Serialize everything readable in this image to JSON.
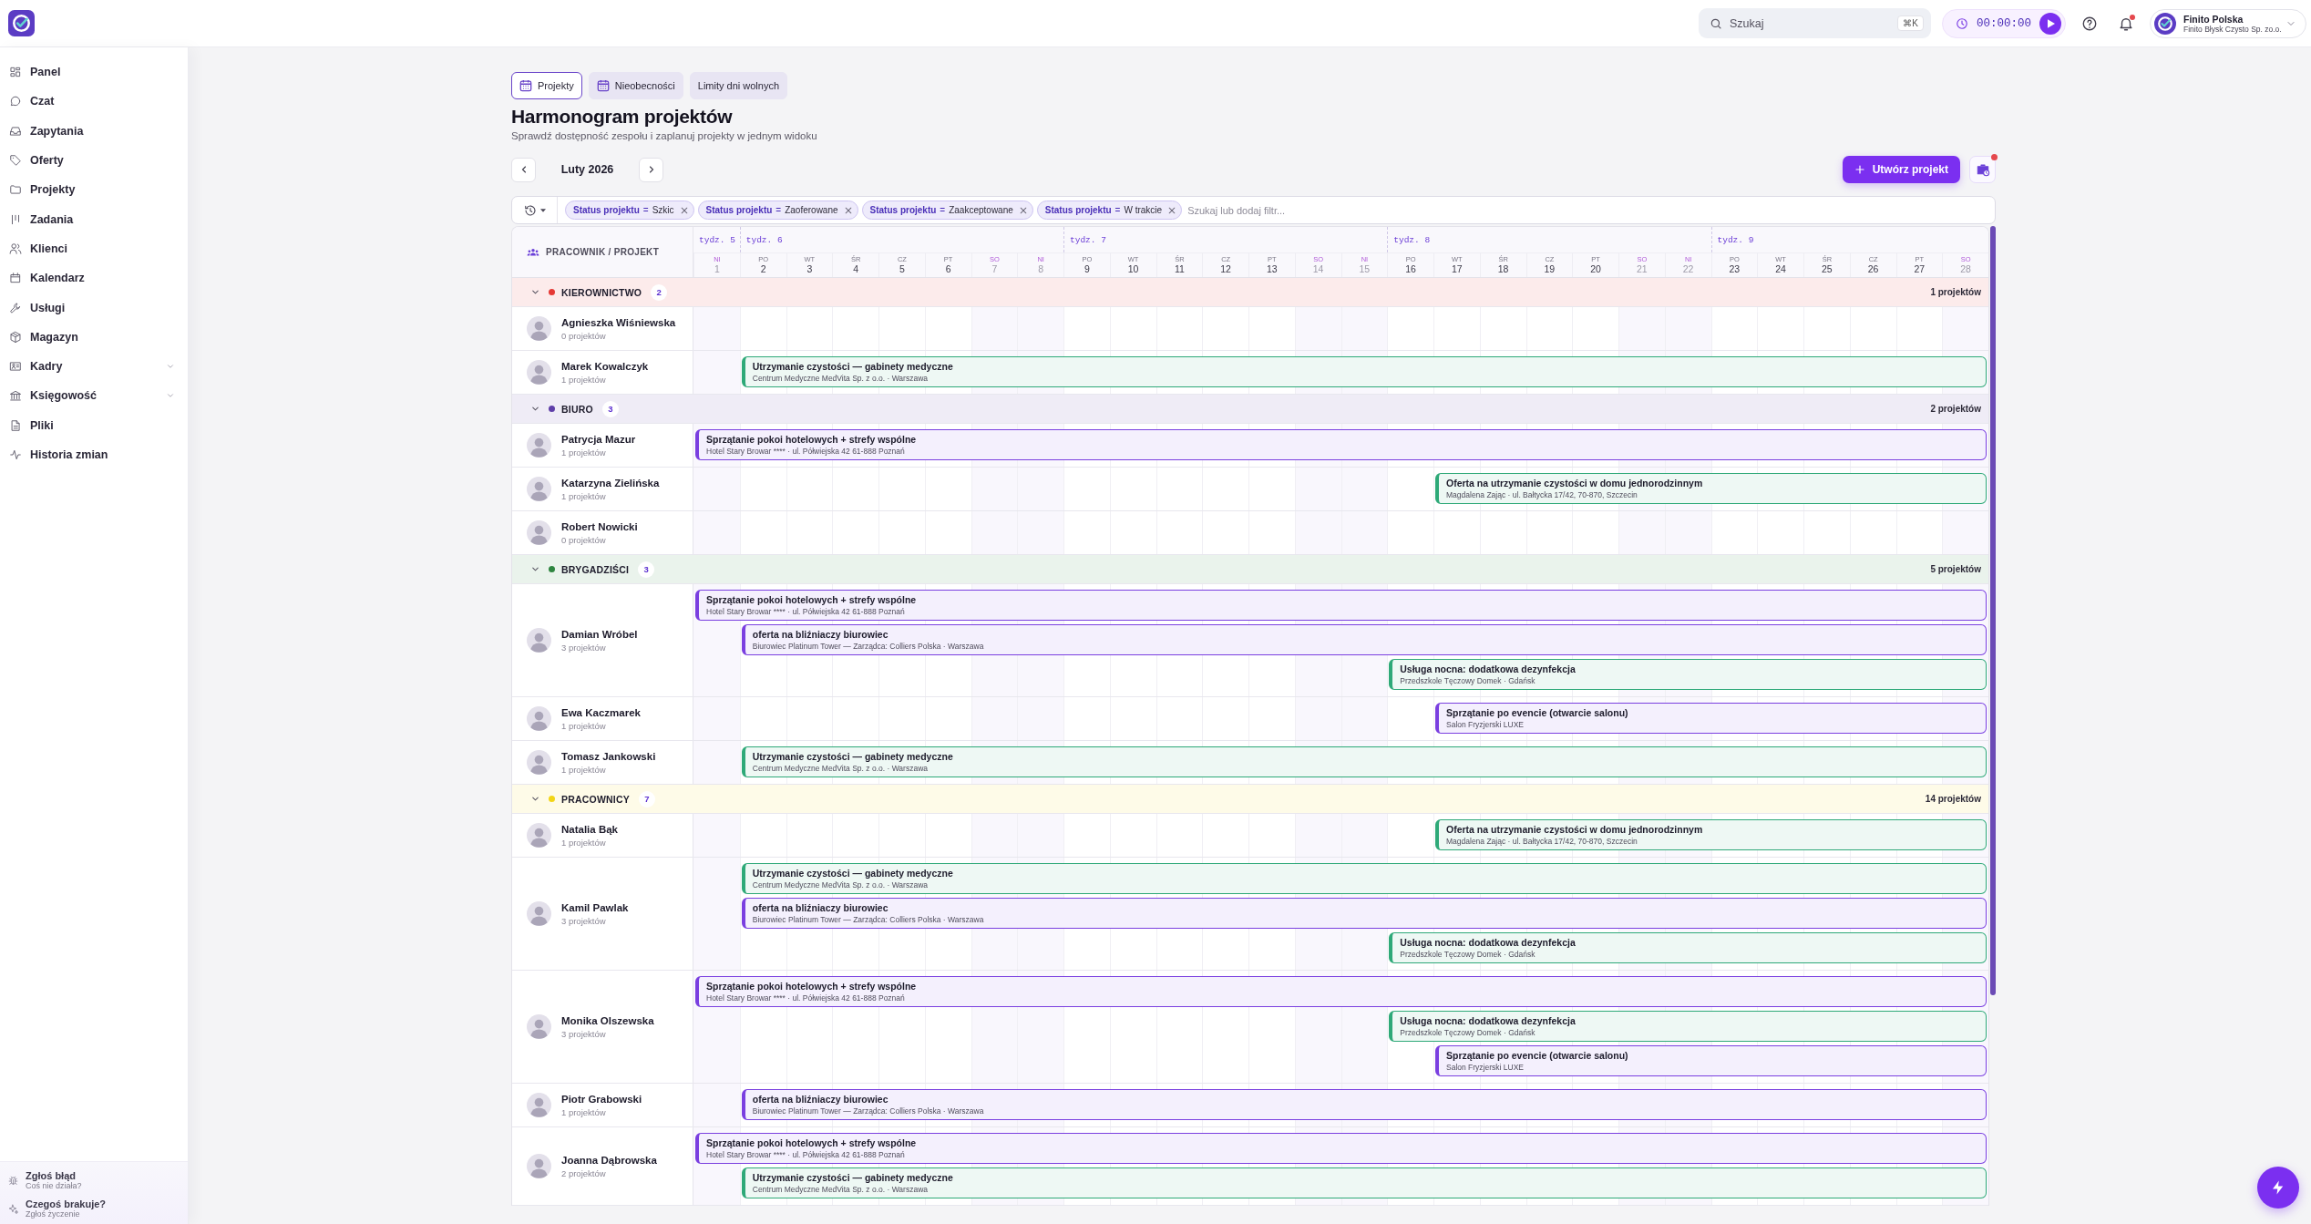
{
  "topbar": {
    "search": {
      "placeholder": "Szukaj",
      "shortcut": "⌘K"
    },
    "timer": {
      "time": "00:00:00"
    },
    "notifications": {
      "unread": true
    },
    "account": {
      "name": "Finito Polska",
      "company": "Finito Błysk Czysto Sp. zo.o."
    }
  },
  "sidebar": {
    "items": [
      {
        "label": "Panel",
        "kind": "link",
        "selected": false
      },
      {
        "label": "Czat",
        "kind": "link",
        "selected": false
      },
      {
        "label": "Zapytania",
        "kind": "link",
        "selected": false
      },
      {
        "label": "Oferty",
        "kind": "link",
        "selected": false
      },
      {
        "label": "Projekty",
        "kind": "link",
        "selected": false
      },
      {
        "label": "Zadania",
        "kind": "link",
        "selected": false
      },
      {
        "label": "Klienci",
        "kind": "link",
        "selected": false
      },
      {
        "label": "Kalendarz",
        "kind": "link",
        "selected": false
      },
      {
        "label": "Usługi",
        "kind": "link",
        "selected": false
      },
      {
        "label": "Magazyn",
        "kind": "link",
        "selected": false
      },
      {
        "label": "Kadry",
        "kind": "group",
        "selected": false
      },
      {
        "label": "Księgowość",
        "kind": "group",
        "selected": false
      },
      {
        "label": "Pliki",
        "kind": "link",
        "selected": false
      },
      {
        "label": "Historia zmian",
        "kind": "link",
        "selected": false
      }
    ],
    "footer": [
      {
        "title": "Zgłoś błąd",
        "subtitle": "Coś nie działa?"
      },
      {
        "title": "Czegoś brakuje?",
        "subtitle": "Zgłoś życzenie"
      }
    ]
  },
  "tabs": [
    {
      "label": "Projekty",
      "selected": true,
      "has_icon": true
    },
    {
      "label": "Nieobecności",
      "selected": false,
      "has_icon": true
    },
    {
      "label": "Limity dni wolnych",
      "selected": false,
      "has_icon": false
    }
  ],
  "page": {
    "title": "Harmonogram projektów",
    "subtitle": "Sprawdź dostępność zespołu i zaplanuj projekty w jednym widoku"
  },
  "toolbar": {
    "month": "Luty 2026",
    "create_button": "Utwórz projekt",
    "side_button": {
      "unread": true
    }
  },
  "filters": {
    "chips": [
      {
        "field": "Status projektu",
        "operator": "=",
        "value": "Szkic"
      },
      {
        "field": "Status projektu",
        "operator": "=",
        "value": "Zaoferowane"
      },
      {
        "field": "Status projektu",
        "operator": "=",
        "value": "Zaakceptowane"
      },
      {
        "field": "Status projektu",
        "operator": "=",
        "value": "W trakcie"
      }
    ],
    "placeholder": "Szukaj lub dodaj filtr..."
  },
  "schedule": {
    "header": "PRACOWNIK / PROJEKT",
    "weeks": [
      {
        "label": "tydz. 5",
        "days": [
          {
            "weekday": "NI",
            "date": "1",
            "weekend": true
          }
        ]
      },
      {
        "label": "tydz. 6",
        "days": [
          {
            "weekday": "PO",
            "date": "2",
            "weekend": false
          },
          {
            "weekday": "WT",
            "date": "3",
            "weekend": false
          },
          {
            "weekday": "ŚR",
            "date": "4",
            "weekend": false
          },
          {
            "weekday": "CZ",
            "date": "5",
            "weekend": false
          },
          {
            "weekday": "PT",
            "date": "6",
            "weekend": false
          },
          {
            "weekday": "SO",
            "date": "7",
            "weekend": true
          },
          {
            "weekday": "NI",
            "date": "8",
            "weekend": true
          }
        ]
      },
      {
        "label": "tydz. 7",
        "days": [
          {
            "weekday": "PO",
            "date": "9",
            "weekend": false
          },
          {
            "weekday": "WT",
            "date": "10",
            "weekend": false
          },
          {
            "weekday": "ŚR",
            "date": "11",
            "weekend": false
          },
          {
            "weekday": "CZ",
            "date": "12",
            "weekend": false
          },
          {
            "weekday": "PT",
            "date": "13",
            "weekend": false
          },
          {
            "weekday": "SO",
            "date": "14",
            "weekend": true
          },
          {
            "weekday": "NI",
            "date": "15",
            "weekend": true
          }
        ]
      },
      {
        "label": "tydz. 8",
        "days": [
          {
            "weekday": "PO",
            "date": "16",
            "weekend": false
          },
          {
            "weekday": "WT",
            "date": "17",
            "weekend": false
          },
          {
            "weekday": "ŚR",
            "date": "18",
            "weekend": false
          },
          {
            "weekday": "CZ",
            "date": "19",
            "weekend": false
          },
          {
            "weekday": "PT",
            "date": "20",
            "weekend": false
          },
          {
            "weekday": "SO",
            "date": "21",
            "weekend": true
          },
          {
            "weekday": "NI",
            "date": "22",
            "weekend": true
          }
        ]
      },
      {
        "label": "tydz. 9",
        "days": [
          {
            "weekday": "PO",
            "date": "23",
            "weekend": false
          },
          {
            "weekday": "WT",
            "date": "24",
            "weekend": false
          },
          {
            "weekday": "ŚR",
            "date": "25",
            "weekend": false
          },
          {
            "weekday": "CZ",
            "date": "26",
            "weekend": false
          },
          {
            "weekday": "PT",
            "date": "27",
            "weekend": false
          },
          {
            "weekday": "SO",
            "date": "28",
            "weekend": true
          }
        ]
      }
    ],
    "groups": [
      {
        "name": "KIEROWNICTWO",
        "color": "#e53935",
        "count": "2",
        "total": "1 projektów",
        "expanded": true,
        "people": [
          {
            "name": "Agnieszka Wiśniewska",
            "projects": "0 projektów"
          },
          {
            "name": "Marek Kowalczyk",
            "projects": "1 projektów",
            "bars": [
              {
                "title": "Utrzymanie czystości — gabinety medyczne",
                "subtitle": "Centrum Medyczne MedVita Sp. z o.o. · Warszawa",
                "color": "#2ea978",
                "level": 0.9643
              }
            ]
          }
        ]
      },
      {
        "name": "BIURO",
        "color": "#5e3ea8",
        "count": "3",
        "total": "2 projektów",
        "expanded": true,
        "people": [
          {
            "name": "Patrycja Mazur",
            "projects": "1 projektów",
            "bars": [
              {
                "title": "Sprzątanie pokoi hotelowych + strefy wspólne",
                "subtitle": "Hotel Stary Browar **** · ul. Półwiejska 42 61-888 Poznań",
                "color": "#7a3fe0",
                "level": 1
              }
            ]
          },
          {
            "name": "Katarzyna Zielińska",
            "projects": "1 projektów",
            "bars": [
              {
                "title": "Oferta na utrzymanie czystości w domu jednorodzinnym",
                "subtitle": "Magdalena Zając · ul. Bałtycka 17/42, 70-870, Szczecin",
                "color": "#2ea978",
                "level": 0.4286
              }
            ]
          },
          {
            "name": "Robert Nowicki",
            "projects": "0 projektów"
          }
        ]
      },
      {
        "name": "BRYGADZIŚCI",
        "color": "#2e8540",
        "count": "3",
        "total": "5 projektów",
        "expanded": true,
        "people": [
          {
            "name": "Damian Wróbel",
            "projects": "3 projektów",
            "bars": [
              {
                "title": "Sprzątanie pokoi hotelowych + strefy wspólne",
                "subtitle": "Hotel Stary Browar **** · ul. Półwiejska 42 61-888 Poznań",
                "color": "#7a3fe0",
                "level": 1
              },
              {
                "title": "oferta na bliźniaczy biurowiec",
                "subtitle": "Biurowiec Platinum Tower — Zarządca: Colliers Polska · Warszawa",
                "color": "#7a3fe0",
                "level": 0.9643
              },
              {
                "title": "Usługa nocna: dodatkowa dezynfekcja",
                "subtitle": "Przedszkole Tęczowy Domek · Gdańsk",
                "color": "#2ea978",
                "level": 0.4643
              }
            ]
          },
          {
            "name": "Ewa Kaczmarek",
            "projects": "1 projektów",
            "bars": [
              {
                "title": "Sprzątanie po evencie (otwarcie salonu)",
                "subtitle": "Salon Fryzjerski LUXE",
                "color": "#7a3fe0",
                "level": 0.4286
              }
            ]
          },
          {
            "name": "Tomasz Jankowski",
            "projects": "1 projektów",
            "bars": [
              {
                "title": "Utrzymanie czystości — gabinety medyczne",
                "subtitle": "Centrum Medyczne MedVita Sp. z o.o. · Warszawa",
                "color": "#2ea978",
                "level": 0.9643
              }
            ]
          }
        ]
      },
      {
        "name": "PRACOWNICY",
        "color": "#f2d516",
        "count": "7",
        "total": "14 projektów",
        "expanded": true,
        "people": [
          {
            "name": "Natalia Bąk",
            "projects": "1 projektów",
            "bars": [
              {
                "title": "Oferta na utrzymanie czystości w domu jednorodzinnym",
                "subtitle": "Magdalena Zając · ul. Bałtycka 17/42, 70-870, Szczecin",
                "color": "#2ea978",
                "level": 0.4286
              }
            ]
          },
          {
            "name": "Kamil Pawlak",
            "projects": "3 projektów",
            "bars": [
              {
                "title": "Utrzymanie czystości — gabinety medyczne",
                "subtitle": "Centrum Medyczne MedVita Sp. z o.o. · Warszawa",
                "color": "#2ea978",
                "level": 0.9643
              },
              {
                "title": "oferta na bliźniaczy biurowiec",
                "subtitle": "Biurowiec Platinum Tower — Zarządca: Colliers Polska · Warszawa",
                "color": "#7a3fe0",
                "level": 0.9643
              },
              {
                "title": "Usługa nocna: dodatkowa dezynfekcja",
                "subtitle": "Przedszkole Tęczowy Domek · Gdańsk",
                "color": "#2ea978",
                "level": 0.4643
              }
            ]
          },
          {
            "name": "Monika Olszewska",
            "projects": "3 projektów",
            "bars": [
              {
                "title": "Sprzątanie pokoi hotelowych + strefy wspólne",
                "subtitle": "Hotel Stary Browar **** · ul. Półwiejska 42 61-888 Poznań",
                "color": "#7a3fe0",
                "level": 1
              },
              {
                "title": "Usługa nocna: dodatkowa dezynfekcja",
                "subtitle": "Przedszkole Tęczowy Domek · Gdańsk",
                "color": "#2ea978",
                "level": 0.4643
              },
              {
                "title": "Sprzątanie po evencie (otwarcie salonu)",
                "subtitle": "Salon Fryzjerski LUXE",
                "color": "#7a3fe0",
                "level": 0.4286
              }
            ]
          },
          {
            "name": "Piotr Grabowski",
            "projects": "1 projektów",
            "bars": [
              {
                "title": "oferta na bliźniaczy biurowiec",
                "subtitle": "Biurowiec Platinum Tower — Zarządca: Colliers Polska · Warszawa",
                "color": "#7a3fe0",
                "level": 0.9643
              }
            ]
          },
          {
            "name": "Joanna Dąbrowska",
            "projects": "2 projektów",
            "bars": [
              {
                "title": "Sprzątanie pokoi hotelowych + strefy wspólne",
                "subtitle": "Hotel Stary Browar **** · ul. Półwiejska 42 61-888 Poznań",
                "color": "#7a3fe0",
                "level": 1
              },
              {
                "title": "Utrzymanie czystości — gabinety medyczne",
                "subtitle": "Centrum Medyczne MedVita Sp. z o.o. · Warszawa",
                "color": "#2ea978",
                "level": 0.9643
              }
            ]
          }
        ]
      }
    ]
  }
}
